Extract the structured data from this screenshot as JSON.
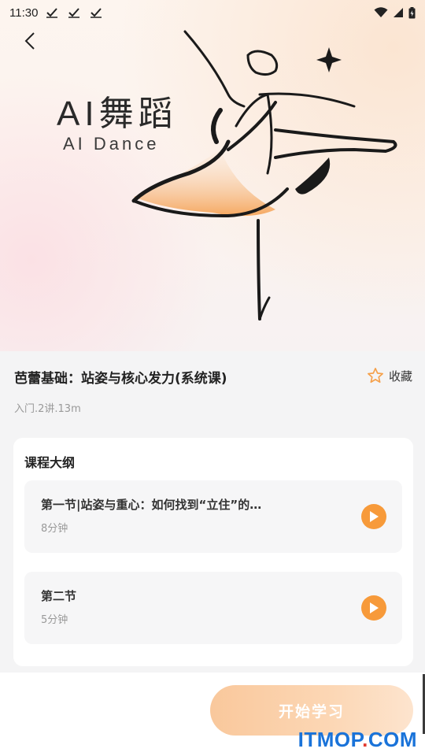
{
  "status_bar": {
    "time": "11:30"
  },
  "hero": {
    "title": "AI舞蹈",
    "subtitle": "AI Dance"
  },
  "course": {
    "title": "芭蕾基础：站姿与核心发力(系统课)",
    "meta": "入门.2讲.13m",
    "favorite_label": "收藏"
  },
  "outline": {
    "title": "课程大纲",
    "lessons": [
      {
        "name": "第一节|站姿与重心：如何找到“立住”的…",
        "duration": "8分钟"
      },
      {
        "name": "第二节",
        "duration": "5分钟"
      }
    ]
  },
  "actions": {
    "start_label": "开始学习"
  },
  "watermark": {
    "text": "ITMOP",
    "dot": ".",
    "suffix": "COM"
  },
  "colors": {
    "accent": "#f79a3a",
    "favorite_star": "#f5a04a",
    "watermark_blue": "#1a73d9"
  }
}
